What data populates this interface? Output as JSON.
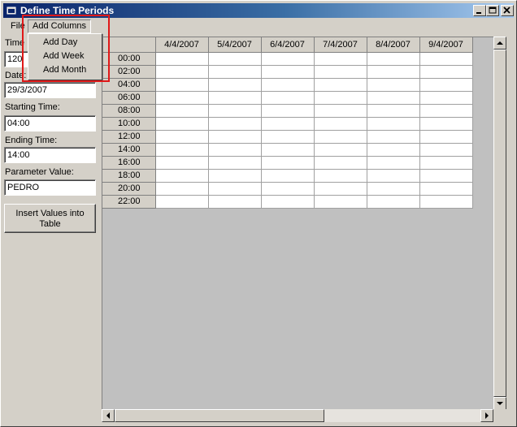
{
  "window": {
    "title": "Define Time Periods"
  },
  "menu": {
    "file": "File",
    "add_columns": "Add Columns",
    "dropdown": [
      "Add Day",
      "Add Week",
      "Add Month"
    ]
  },
  "form": {
    "time_label_visible": "Time I",
    "time_value_visible": "120",
    "date_label_visible": "Date:",
    "date_value": "29/3/2007",
    "starting_time_label": "Starting Time:",
    "starting_time_value": "04:00",
    "ending_time_label": "Ending Time:",
    "ending_time_value": "14:00",
    "parameter_value_label": "Parameter Value:",
    "parameter_value": "PEDRO",
    "insert_button": "Insert Values into Table"
  },
  "grid": {
    "columns": [
      "4/4/2007",
      "5/4/2007",
      "6/4/2007",
      "7/4/2007",
      "8/4/2007",
      "9/4/2007"
    ],
    "rows": [
      "00:00",
      "02:00",
      "04:00",
      "06:00",
      "08:00",
      "10:00",
      "12:00",
      "14:00",
      "16:00",
      "18:00",
      "20:00",
      "22:00"
    ]
  },
  "colors": {
    "highlight": "#e01818",
    "titlebar_start": "#0a246a"
  }
}
